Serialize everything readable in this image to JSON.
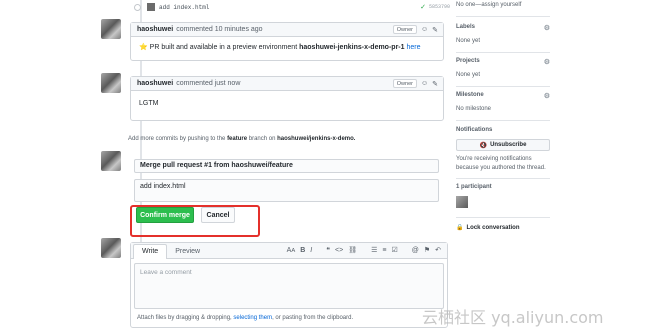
{
  "commit": {
    "message": "add index.html",
    "sha": "5853790"
  },
  "comments": [
    {
      "author": "haoshuwei",
      "meta": "commented 10 minutes ago",
      "badge": "Owner",
      "emoji": "⭐",
      "body_prefix": "PR built and available in a preview environment",
      "body_strong": "haoshuwei-jenkins-x-demo-pr-1",
      "body_link": "here"
    },
    {
      "author": "haoshuwei",
      "meta": "commented just now",
      "badge": "Owner",
      "body": "LGTM"
    }
  ],
  "push_hint": {
    "prefix": "Add more commits by pushing to the",
    "branch": "feature",
    "middle": "branch on",
    "repo": "haoshuwei/jenkins-x-demo."
  },
  "merge": {
    "title_value": "Merge pull request #1 from haoshuwei/feature",
    "message_value": "add index.html",
    "confirm_label": "Confirm merge",
    "cancel_label": "Cancel"
  },
  "editor": {
    "tab_write": "Write",
    "tab_preview": "Preview",
    "placeholder": "Leave a comment",
    "attach_prefix": "Attach files by dragging & dropping,",
    "attach_link": "selecting them",
    "attach_suffix": ", or pasting from the clipboard.",
    "toolbar_icons": [
      "text-size-icon",
      "bold-icon",
      "italic-icon",
      "quote-icon",
      "code-icon",
      "link-icon",
      "unordered-list-icon",
      "ordered-list-icon",
      "task-list-icon",
      "mention-icon",
      "bookmark-icon",
      "reply-icon"
    ]
  },
  "sidebar": {
    "assignees_value": "No one—assign yourself",
    "labels_heading": "Labels",
    "labels_value": "None yet",
    "projects_heading": "Projects",
    "projects_value": "None yet",
    "milestone_heading": "Milestone",
    "milestone_value": "No milestone",
    "notifications_heading": "Notifications",
    "unsubscribe_label": "Unsubscribe",
    "notifications_note": "You're receiving notifications because you authored the thread.",
    "participants_heading": "1 participant",
    "lock_label": "Lock conversation"
  },
  "watermark": "云栖社区 yq.aliyun.com",
  "colors": {
    "merge_green": "#2cbe4e",
    "link_blue": "#0366d6",
    "highlight_red": "#e4302b"
  }
}
